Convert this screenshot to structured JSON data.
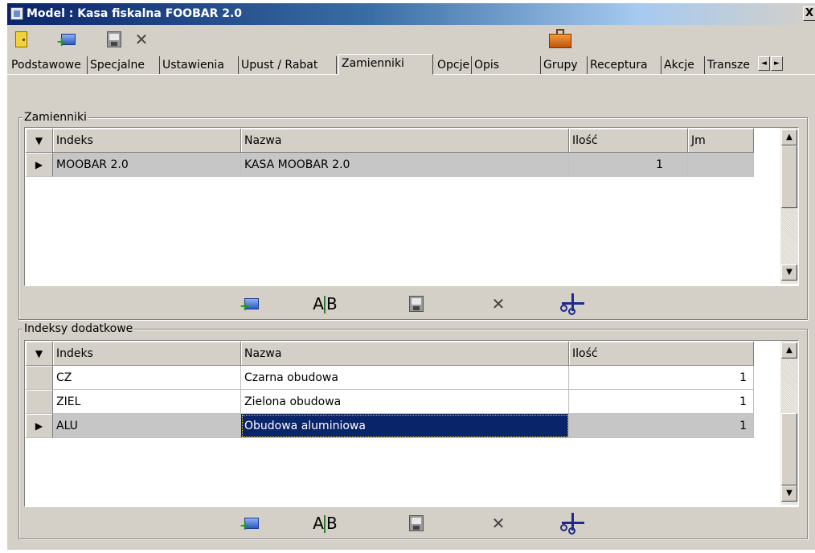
{
  "window": {
    "title": "Model : Kasa fiskalna FOOBAR 2.0",
    "close_label": "X"
  },
  "toolbar": {
    "buttons": [
      "exit-door-icon",
      "add-item-icon",
      "save-disk-icon",
      "delete-x-icon",
      "briefcase-icon"
    ],
    "delete_glyph": "✕"
  },
  "tabs": {
    "items": [
      "Podstawowe",
      "Specjalne",
      "Ustawienia",
      "Upust / Rabat",
      "Zamienniki",
      "Opcje",
      "Opis",
      "Grupy",
      "Receptura",
      "Akcje",
      "Transze"
    ],
    "active": "Zamienniki",
    "scroll_left": "◄",
    "scroll_right": "►"
  },
  "zamienniki": {
    "group_title": "Zamienniki",
    "indicator_header": "▼",
    "columns": [
      "Indeks",
      "Nazwa",
      "Ilość",
      "Jm"
    ],
    "rows": [
      {
        "indicator": "▶",
        "indeks": "MOOBAR 2.0",
        "nazwa": "KASA MOOBAR 2.0",
        "ilosc": "1",
        "jm": ""
      }
    ],
    "scroll_up": "▲",
    "scroll_down": "▼"
  },
  "indeksy": {
    "group_title": "Indeksy dodatkowe",
    "indicator_header": "▼",
    "columns": [
      "Indeks",
      "Nazwa",
      "Ilość"
    ],
    "rows": [
      {
        "indicator": "",
        "indeks": "CZ",
        "nazwa": "Czarna obudowa",
        "ilosc": "1"
      },
      {
        "indicator": "",
        "indeks": "ZIEL",
        "nazwa": "Zielona obudowa",
        "ilosc": "1"
      },
      {
        "indicator": "▶",
        "indeks": "ALU",
        "nazwa": "Obudowa aluminiowa",
        "ilosc": "1"
      }
    ],
    "scroll_up": "▲",
    "scroll_down": "▼"
  },
  "grid_toolbar": {
    "ab_text_a": "A",
    "ab_text_b": "B",
    "delete_glyph": "✕"
  },
  "colors": {
    "title_active": "#0a246a",
    "selection": "#0a246a",
    "selected_row": "#c6c6c6",
    "face": "#d4d0c8"
  }
}
